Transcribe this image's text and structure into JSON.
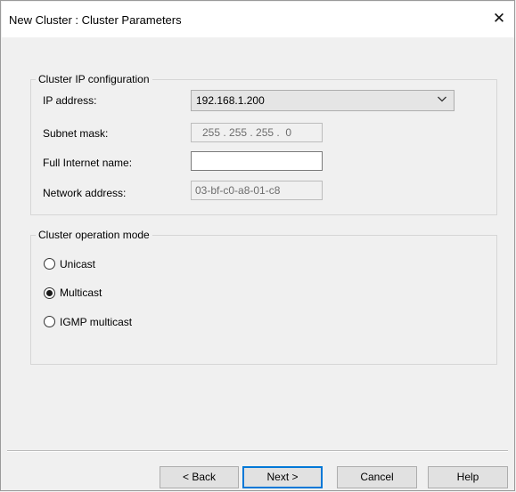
{
  "window": {
    "title": "New Cluster : Cluster Parameters",
    "close_glyph": "✕"
  },
  "ip_config": {
    "legend": "Cluster IP configuration",
    "ip_label": "IP address:",
    "ip_value": "192.168.1.200",
    "subnet_label": "Subnet mask:",
    "subnet_value": "255 . 255 . 255 .  0",
    "internet_label": "Full Internet name:",
    "internet_value": "",
    "network_label": "Network address:",
    "network_value": "03-bf-c0-a8-01-c8"
  },
  "op_mode": {
    "legend": "Cluster operation mode",
    "options": [
      {
        "label": "Unicast",
        "selected": false
      },
      {
        "label": "Multicast",
        "selected": true
      },
      {
        "label": "IGMP multicast",
        "selected": false
      }
    ]
  },
  "buttons": {
    "back": "< Back",
    "next": "Next >",
    "cancel": "Cancel",
    "help": "Help"
  },
  "icons": {
    "dropdown": "chevron-down-icon",
    "close": "close-icon"
  }
}
